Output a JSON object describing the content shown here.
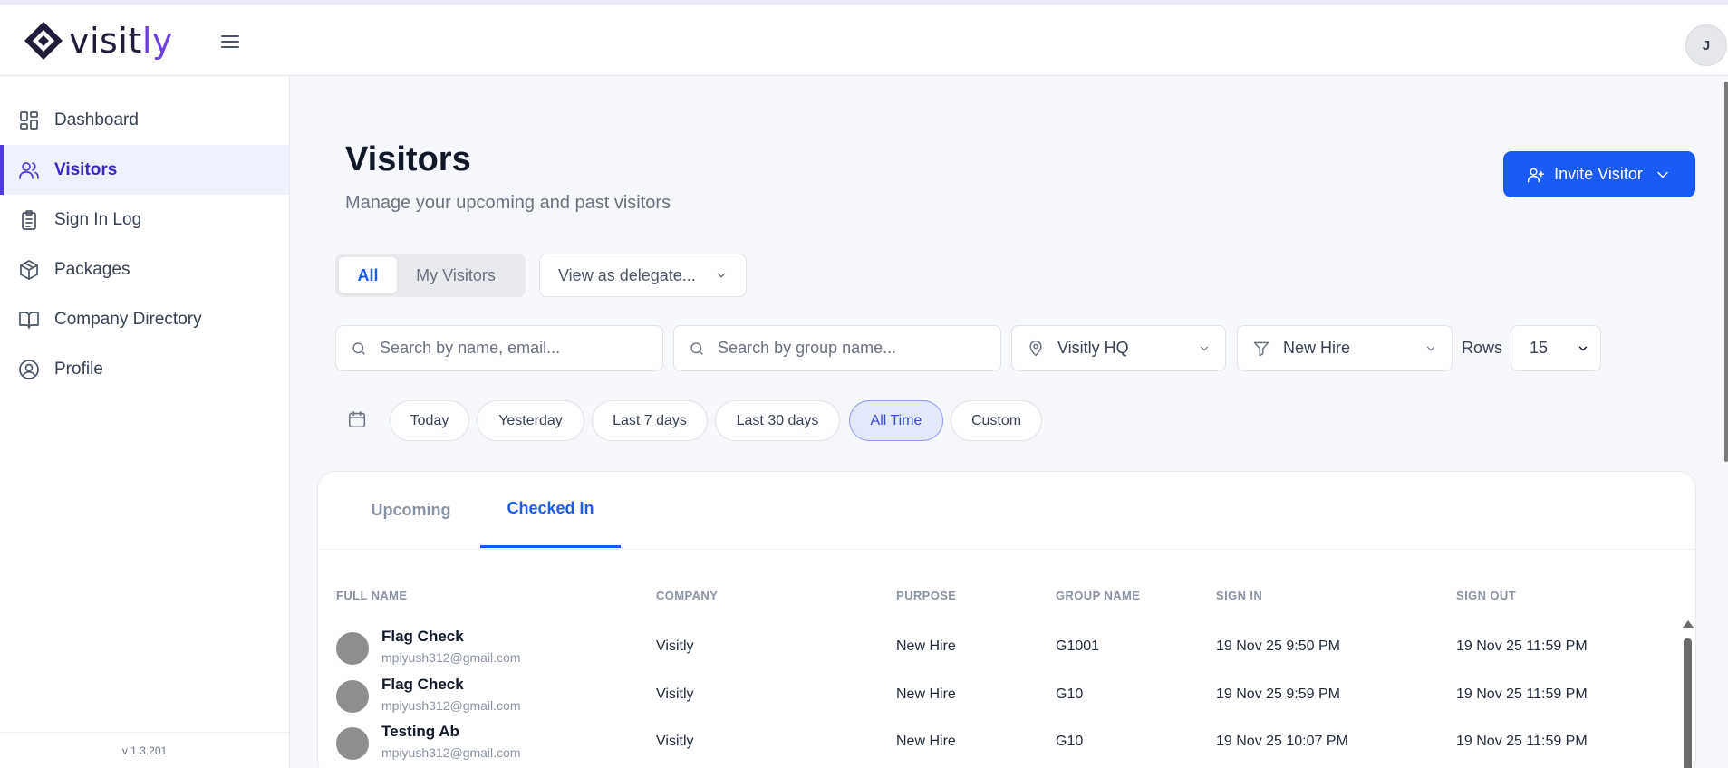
{
  "app": {
    "logo_text_main": "visit",
    "logo_text_accent": "ly",
    "user_initial": "J",
    "version": "v 1.3.201",
    "brand_color": "#6d3fe0",
    "primary_color": "#1a5bf5"
  },
  "sidebar": {
    "items": [
      {
        "label": "Dashboard",
        "icon": "dashboard-icon"
      },
      {
        "label": "Visitors",
        "icon": "users-icon",
        "active": true
      },
      {
        "label": "Sign In Log",
        "icon": "clipboard-icon"
      },
      {
        "label": "Packages",
        "icon": "package-icon"
      },
      {
        "label": "Company Directory",
        "icon": "book-icon"
      },
      {
        "label": "Profile",
        "icon": "user-circle-icon"
      }
    ]
  },
  "page": {
    "title": "Visitors",
    "subtitle": "Manage your upcoming and past visitors",
    "invite_label": "Invite Visitor"
  },
  "toggle": {
    "all_label": "All",
    "mine_label": "My Visitors",
    "delegate_label": "View as delegate..."
  },
  "filters": {
    "search_name_placeholder": "Search by name, email...",
    "search_group_placeholder": "Search by group name...",
    "location": "Visitly HQ",
    "purpose": "New Hire",
    "rows_label": "Rows",
    "rows_value": "15"
  },
  "date_filters": {
    "options": [
      "Today",
      "Yesterday",
      "Last 7 days",
      "Last 30 days",
      "All Time",
      "Custom"
    ],
    "selected": "All Time"
  },
  "tabs": {
    "upcoming": "Upcoming",
    "checked_in": "Checked In",
    "active": "Checked In"
  },
  "table": {
    "headers": [
      "FULL NAME",
      "COMPANY",
      "PURPOSE",
      "GROUP NAME",
      "SIGN IN",
      "SIGN OUT"
    ],
    "rows": [
      {
        "name": "Flag Check",
        "email": "mpiyush312@gmail.com",
        "company": "Visitly",
        "purpose": "New Hire",
        "group": "G1001",
        "sign_in": "19 Nov 25 9:50 PM",
        "sign_out": "19 Nov 25 11:59 PM"
      },
      {
        "name": "Flag Check",
        "email": "mpiyush312@gmail.com",
        "company": "Visitly",
        "purpose": "New Hire",
        "group": "G10",
        "sign_in": "19 Nov 25 9:59 PM",
        "sign_out": "19 Nov 25 11:59 PM"
      },
      {
        "name": "Testing Ab",
        "email": "mpiyush312@gmail.com",
        "company": "Visitly",
        "purpose": "New Hire",
        "group": "G10",
        "sign_in": "19 Nov 25 10:07 PM",
        "sign_out": "19 Nov 25 11:59 PM"
      }
    ]
  }
}
